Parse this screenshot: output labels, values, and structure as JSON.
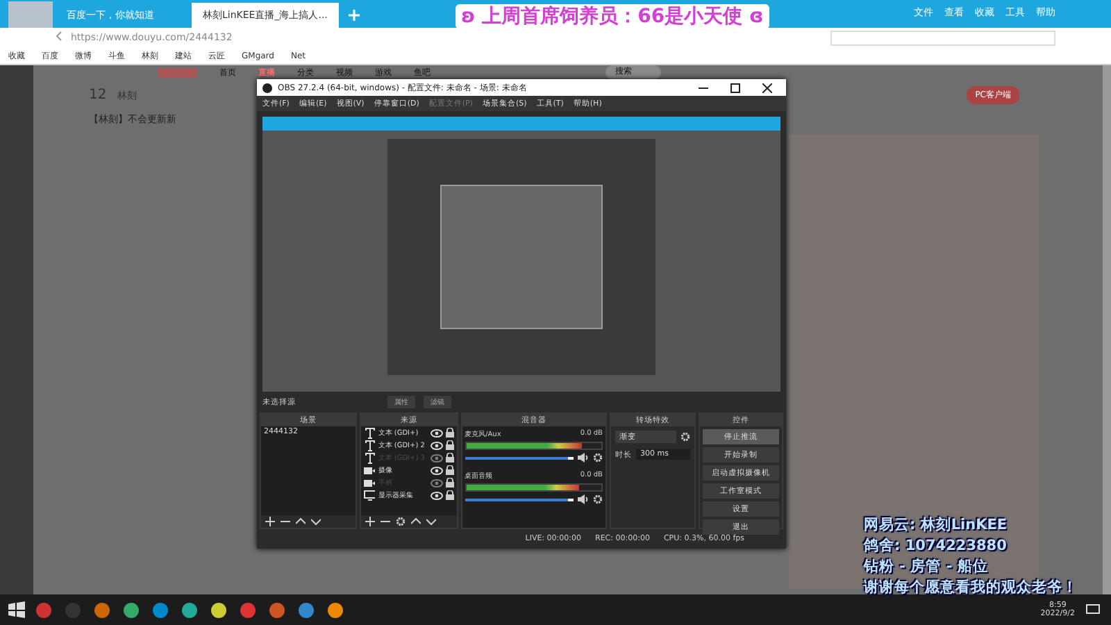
{
  "browser": {
    "tabs": [
      {
        "label": "百度一下，你就知道",
        "selected": false
      },
      {
        "label": "林刻LinKEE直播_海上搞人...",
        "selected": true
      }
    ],
    "menu": [
      "文件",
      "查看",
      "收藏",
      "工具",
      "帮助"
    ],
    "url": "https://www.douyu.com/2444132",
    "bookmarks": [
      "收藏",
      "百度",
      "微博",
      "斗鱼",
      "林刻",
      "建站",
      "云匠",
      "GMgard",
      "Net"
    ]
  },
  "overlay_title": "ʚ 上周首席饲养员：66是小天使 ɞ",
  "site": {
    "nav": [
      {
        "label": "首页",
        "selected": false
      },
      {
        "label": "直播",
        "selected": true
      },
      {
        "label": "分类",
        "selected": false
      },
      {
        "label": "视频",
        "selected": false
      },
      {
        "label": "游戏",
        "selected": false
      },
      {
        "label": "鱼吧",
        "selected": false
      }
    ],
    "search_placeholder": "搜索",
    "level": "12",
    "streamer": "林刻",
    "room_title": "【林刻】不会更新新",
    "client_button": "PC客户端"
  },
  "obs": {
    "title": "OBS 27.2.4 (64-bit, windows) - 配置文件: 未命名 - 场景: 未命名",
    "menu": [
      {
        "label": "文件(F)",
        "disabled": false
      },
      {
        "label": "编辑(E)",
        "disabled": false
      },
      {
        "label": "视图(V)",
        "disabled": false
      },
      {
        "label": "停靠窗口(D)",
        "disabled": false
      },
      {
        "label": "配置文件(P)",
        "disabled": true
      },
      {
        "label": "场景集合(S)",
        "disabled": false
      },
      {
        "label": "工具(T)",
        "disabled": false
      },
      {
        "label": "帮助(H)",
        "disabled": false
      }
    ],
    "no_source": "未选择源",
    "source_buttons": [
      "属性",
      "滤镜"
    ],
    "docks": {
      "scenes": "场景",
      "sources": "来源",
      "mixer": "混音器",
      "transitions": "转场特效",
      "controls": "控件"
    },
    "scenes": [
      {
        "name": "2444132",
        "selected": false
      }
    ],
    "sources": [
      {
        "kind": "text",
        "name": "文本 (GDI+)",
        "visible": true
      },
      {
        "kind": "text",
        "name": "文本 (GDI+) 2",
        "visible": true
      },
      {
        "kind": "text",
        "name": "文本 (GDI+) 3",
        "visible": false
      },
      {
        "kind": "camera",
        "name": "摄像",
        "visible": true
      },
      {
        "kind": "camera",
        "name": "手柄",
        "visible": false
      },
      {
        "kind": "display",
        "name": "显示器采集",
        "visible": true
      }
    ],
    "channels": [
      {
        "name": "麦克风/Aux",
        "reading": "0.0 dB",
        "level": 0.86,
        "volume": {
          "level": 0.95
        }
      },
      {
        "name": "桌面音频",
        "reading": "0.0 dB",
        "level": 0.84,
        "volume": {
          "level": 0.95
        }
      }
    ],
    "transition": {
      "value": "渐变",
      "duration_label": "时长",
      "duration": "300 ms"
    },
    "controls": [
      {
        "label": "停止推流",
        "selected": true
      },
      {
        "label": "开始录制",
        "selected": false
      },
      {
        "label": "启动虚拟摄像机",
        "selected": false
      },
      {
        "label": "工作室模式",
        "selected": false
      },
      {
        "label": "设置",
        "selected": false
      },
      {
        "label": "退出",
        "selected": false
      }
    ],
    "status": {
      "live": "LIVE: 00:00:00",
      "rec": "REC: 00:00:00",
      "cpu": "CPU: 0.3%, 60.00 fps"
    }
  },
  "stream_info": [
    "网易云: 林刻LinKEE",
    "鸽舍: 1074223880",
    "钻粉 - 房管 - 船位",
    "谢谢每个愿意看我的观众老爷！"
  ],
  "taskbar": {
    "time": "8:59",
    "date": "2022/9/2"
  }
}
